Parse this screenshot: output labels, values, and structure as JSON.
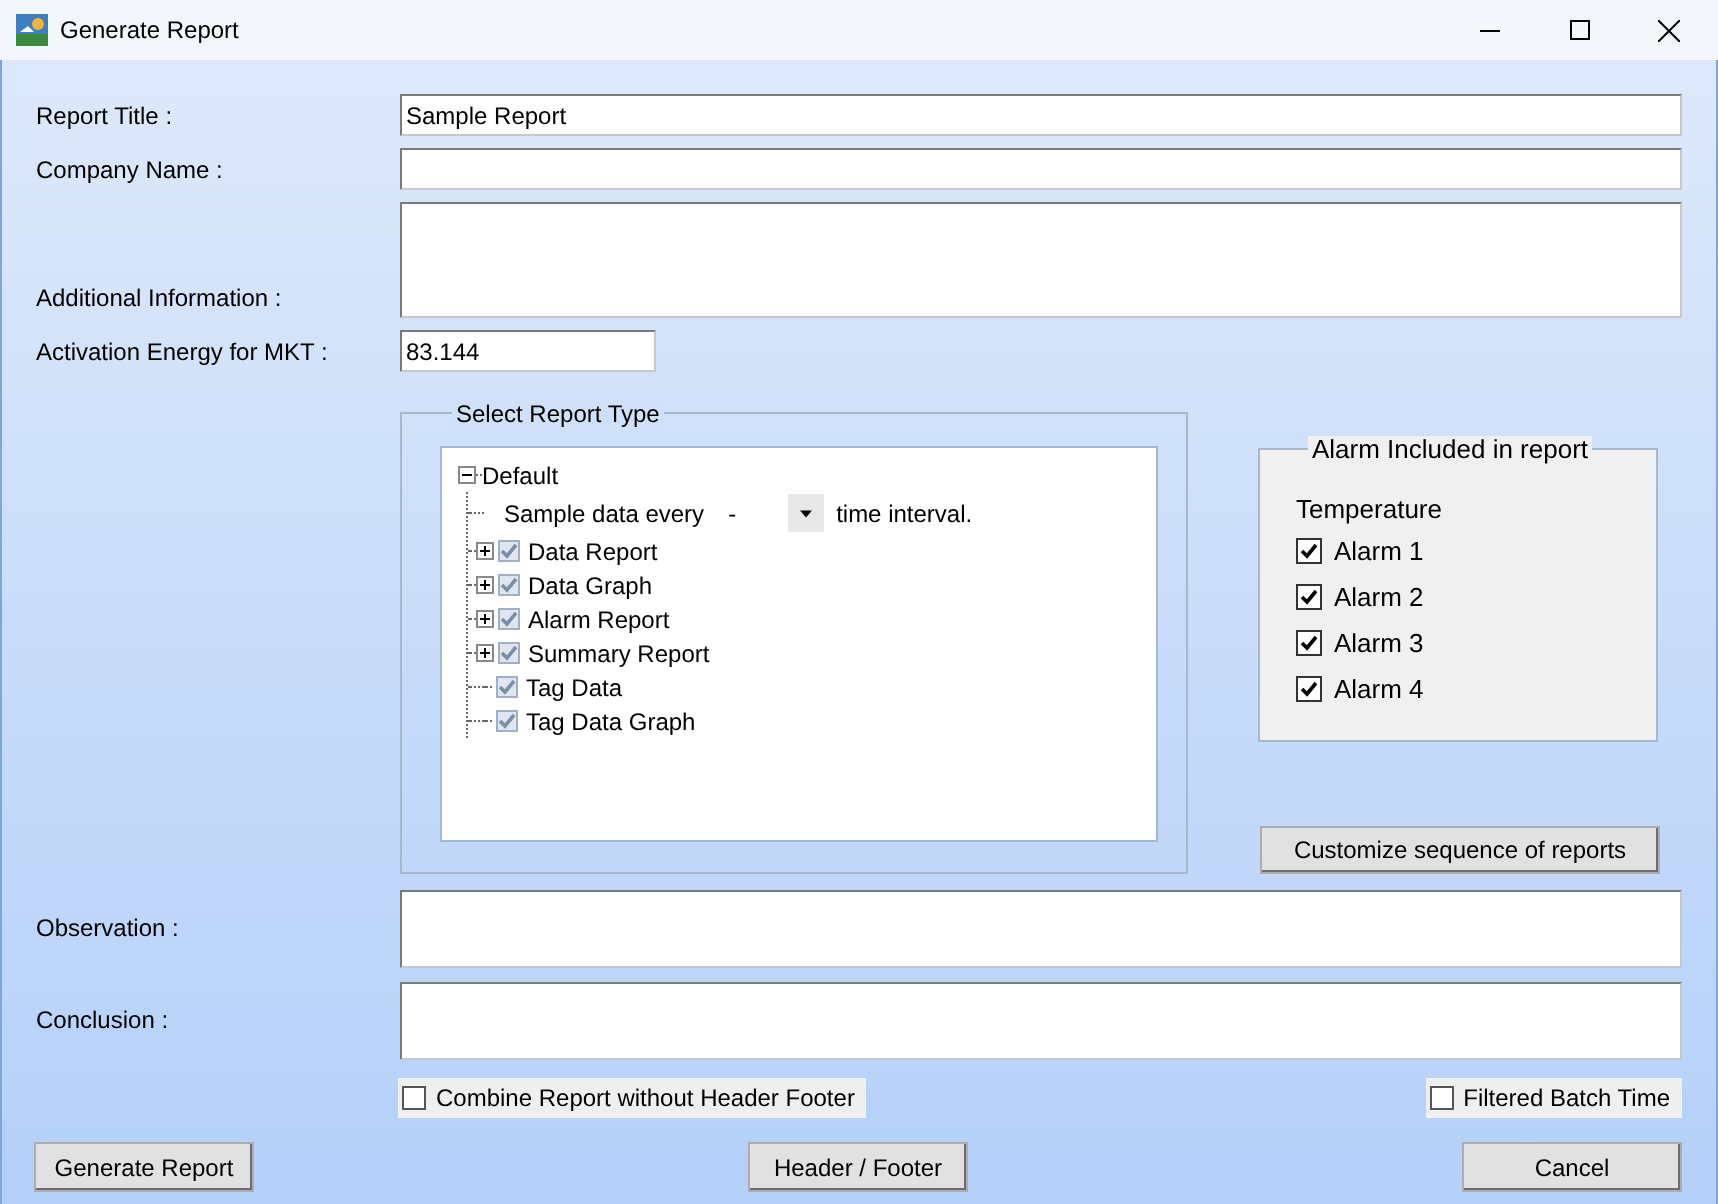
{
  "window": {
    "title": "Generate Report"
  },
  "fields": [
    {
      "label": "Report Title :",
      "value": "Sample Report",
      "kind": "line"
    },
    {
      "label": "Company Name :",
      "kind": "line"
    },
    {
      "label": "Additional Information :",
      "kind": "area"
    },
    {
      "label": "Activation Energy for MKT :",
      "value": "83.144",
      "kind": "short"
    }
  ],
  "report_type": {
    "title": "Select Report Type",
    "tree": [
      {
        "label": "Default",
        "kind": "branch",
        "expanded": true,
        "children": [
          {
            "kind": "sample",
            "label": "Sample data every",
            "value": "-",
            "suffix": "time interval."
          },
          {
            "kind": "branch",
            "label": "Data Report",
            "checked": true,
            "expanded": false
          },
          {
            "kind": "branch",
            "label": "Data Graph",
            "checked": true,
            "expanded": false
          },
          {
            "kind": "branch",
            "label": "Alarm Report",
            "checked": true,
            "expanded": false
          },
          {
            "kind": "branch",
            "label": "Summary Report",
            "checked": true,
            "expanded": false
          },
          {
            "kind": "leaf",
            "label": "Tag Data",
            "checked": true
          },
          {
            "kind": "leaf",
            "label": "Tag Data Graph",
            "checked": true
          }
        ]
      }
    ]
  },
  "alarms": {
    "title": "Alarm Included in report",
    "group": "Temperature",
    "items": [
      {
        "label": "Alarm 1",
        "checked": true
      },
      {
        "label": "Alarm 2",
        "checked": true
      },
      {
        "label": "Alarm 3",
        "checked": true
      },
      {
        "label": "Alarm 4",
        "checked": true
      }
    ]
  },
  "customize_button": "Customize sequence of reports",
  "notes": [
    {
      "label": "Observation :"
    },
    {
      "label": "Conclusion :"
    }
  ],
  "options": [
    {
      "label": "Combine Report without Header Footer",
      "checked": false
    },
    {
      "label": "Filtered Batch Time",
      "checked": false
    }
  ],
  "buttons": [
    "Generate Report",
    "Header / Footer",
    "Cancel"
  ]
}
